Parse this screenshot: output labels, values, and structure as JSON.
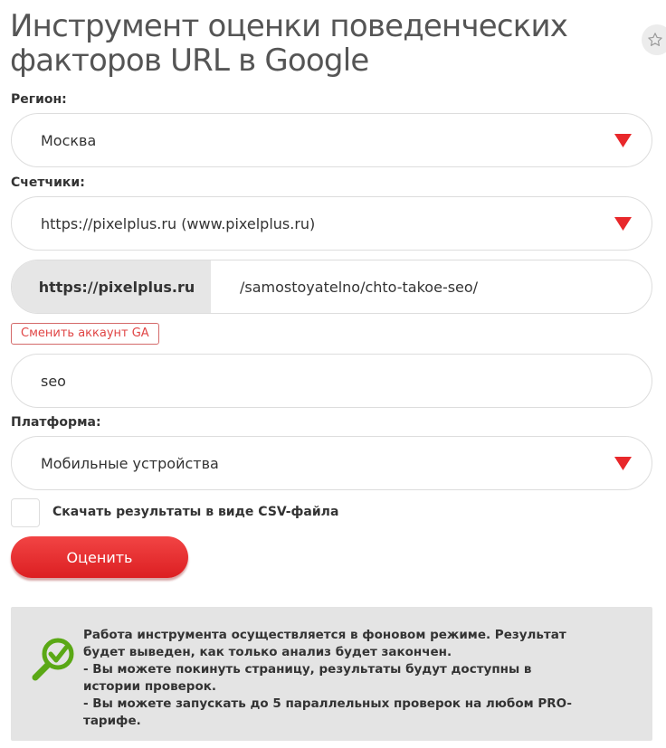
{
  "page": {
    "title": "Инструмент оценки поведенческих факторов URL в Google"
  },
  "region": {
    "label": "Регион:",
    "value": "Москва"
  },
  "counters": {
    "label": "Счетчики:",
    "value": "https://pixelplus.ru (www.pixelplus.ru)"
  },
  "url": {
    "prefix": "https://pixelplus.ru",
    "path": "/samostoyatelno/chto-takoe-seo/"
  },
  "change_account": {
    "label": "Сменить аккаунт GA"
  },
  "keyword": {
    "value": "seo"
  },
  "platform": {
    "label": "Платформа:",
    "value": "Мобильные устройства"
  },
  "csv": {
    "label": "Скачать результаты в виде CSV-файла",
    "checked": false
  },
  "submit": {
    "label": "Оценить"
  },
  "info": {
    "lines": [
      "Работа инструмента осуществляется в фоновом режиме. Результат будет выведен, как только анализ будет закончен.",
      "- Вы можете покинуть страницу, результаты будут доступны в истории проверок.",
      "- Вы можете запускать до 5 параллельных проверок на любом PRO-тарифе."
    ]
  },
  "colors": {
    "accent": "#e8282b",
    "icon_green": "#5aa815",
    "info_bg": "#e4e4e4"
  },
  "icons": {
    "favorite": "star-icon",
    "select_arrow": "triangle-down-icon",
    "info": "magnifier-check-icon"
  }
}
